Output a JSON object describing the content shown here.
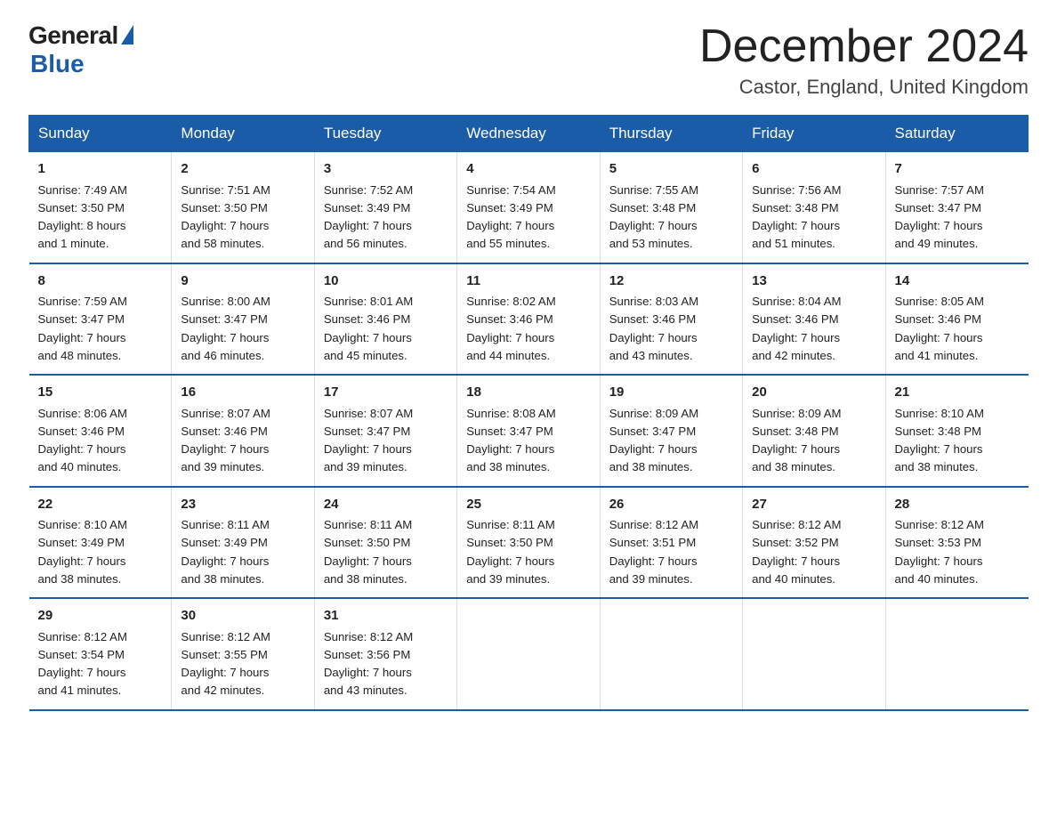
{
  "header": {
    "logo_general": "General",
    "logo_blue": "Blue",
    "month_title": "December 2024",
    "location": "Castor, England, United Kingdom"
  },
  "days_of_week": [
    "Sunday",
    "Monday",
    "Tuesday",
    "Wednesday",
    "Thursday",
    "Friday",
    "Saturday"
  ],
  "weeks": [
    [
      {
        "num": "1",
        "sunrise": "7:49 AM",
        "sunset": "3:50 PM",
        "daylight": "8 hours and 1 minute."
      },
      {
        "num": "2",
        "sunrise": "7:51 AM",
        "sunset": "3:50 PM",
        "daylight": "7 hours and 58 minutes."
      },
      {
        "num": "3",
        "sunrise": "7:52 AM",
        "sunset": "3:49 PM",
        "daylight": "7 hours and 56 minutes."
      },
      {
        "num": "4",
        "sunrise": "7:54 AM",
        "sunset": "3:49 PM",
        "daylight": "7 hours and 55 minutes."
      },
      {
        "num": "5",
        "sunrise": "7:55 AM",
        "sunset": "3:48 PM",
        "daylight": "7 hours and 53 minutes."
      },
      {
        "num": "6",
        "sunrise": "7:56 AM",
        "sunset": "3:48 PM",
        "daylight": "7 hours and 51 minutes."
      },
      {
        "num": "7",
        "sunrise": "7:57 AM",
        "sunset": "3:47 PM",
        "daylight": "7 hours and 49 minutes."
      }
    ],
    [
      {
        "num": "8",
        "sunrise": "7:59 AM",
        "sunset": "3:47 PM",
        "daylight": "7 hours and 48 minutes."
      },
      {
        "num": "9",
        "sunrise": "8:00 AM",
        "sunset": "3:47 PM",
        "daylight": "7 hours and 46 minutes."
      },
      {
        "num": "10",
        "sunrise": "8:01 AM",
        "sunset": "3:46 PM",
        "daylight": "7 hours and 45 minutes."
      },
      {
        "num": "11",
        "sunrise": "8:02 AM",
        "sunset": "3:46 PM",
        "daylight": "7 hours and 44 minutes."
      },
      {
        "num": "12",
        "sunrise": "8:03 AM",
        "sunset": "3:46 PM",
        "daylight": "7 hours and 43 minutes."
      },
      {
        "num": "13",
        "sunrise": "8:04 AM",
        "sunset": "3:46 PM",
        "daylight": "7 hours and 42 minutes."
      },
      {
        "num": "14",
        "sunrise": "8:05 AM",
        "sunset": "3:46 PM",
        "daylight": "7 hours and 41 minutes."
      }
    ],
    [
      {
        "num": "15",
        "sunrise": "8:06 AM",
        "sunset": "3:46 PM",
        "daylight": "7 hours and 40 minutes."
      },
      {
        "num": "16",
        "sunrise": "8:07 AM",
        "sunset": "3:46 PM",
        "daylight": "7 hours and 39 minutes."
      },
      {
        "num": "17",
        "sunrise": "8:07 AM",
        "sunset": "3:47 PM",
        "daylight": "7 hours and 39 minutes."
      },
      {
        "num": "18",
        "sunrise": "8:08 AM",
        "sunset": "3:47 PM",
        "daylight": "7 hours and 38 minutes."
      },
      {
        "num": "19",
        "sunrise": "8:09 AM",
        "sunset": "3:47 PM",
        "daylight": "7 hours and 38 minutes."
      },
      {
        "num": "20",
        "sunrise": "8:09 AM",
        "sunset": "3:48 PM",
        "daylight": "7 hours and 38 minutes."
      },
      {
        "num": "21",
        "sunrise": "8:10 AM",
        "sunset": "3:48 PM",
        "daylight": "7 hours and 38 minutes."
      }
    ],
    [
      {
        "num": "22",
        "sunrise": "8:10 AM",
        "sunset": "3:49 PM",
        "daylight": "7 hours and 38 minutes."
      },
      {
        "num": "23",
        "sunrise": "8:11 AM",
        "sunset": "3:49 PM",
        "daylight": "7 hours and 38 minutes."
      },
      {
        "num": "24",
        "sunrise": "8:11 AM",
        "sunset": "3:50 PM",
        "daylight": "7 hours and 38 minutes."
      },
      {
        "num": "25",
        "sunrise": "8:11 AM",
        "sunset": "3:50 PM",
        "daylight": "7 hours and 39 minutes."
      },
      {
        "num": "26",
        "sunrise": "8:12 AM",
        "sunset": "3:51 PM",
        "daylight": "7 hours and 39 minutes."
      },
      {
        "num": "27",
        "sunrise": "8:12 AM",
        "sunset": "3:52 PM",
        "daylight": "7 hours and 40 minutes."
      },
      {
        "num": "28",
        "sunrise": "8:12 AM",
        "sunset": "3:53 PM",
        "daylight": "7 hours and 40 minutes."
      }
    ],
    [
      {
        "num": "29",
        "sunrise": "8:12 AM",
        "sunset": "3:54 PM",
        "daylight": "7 hours and 41 minutes."
      },
      {
        "num": "30",
        "sunrise": "8:12 AM",
        "sunset": "3:55 PM",
        "daylight": "7 hours and 42 minutes."
      },
      {
        "num": "31",
        "sunrise": "8:12 AM",
        "sunset": "3:56 PM",
        "daylight": "7 hours and 43 minutes."
      },
      null,
      null,
      null,
      null
    ]
  ],
  "labels": {
    "sunrise": "Sunrise:",
    "sunset": "Sunset:",
    "daylight": "Daylight:"
  }
}
